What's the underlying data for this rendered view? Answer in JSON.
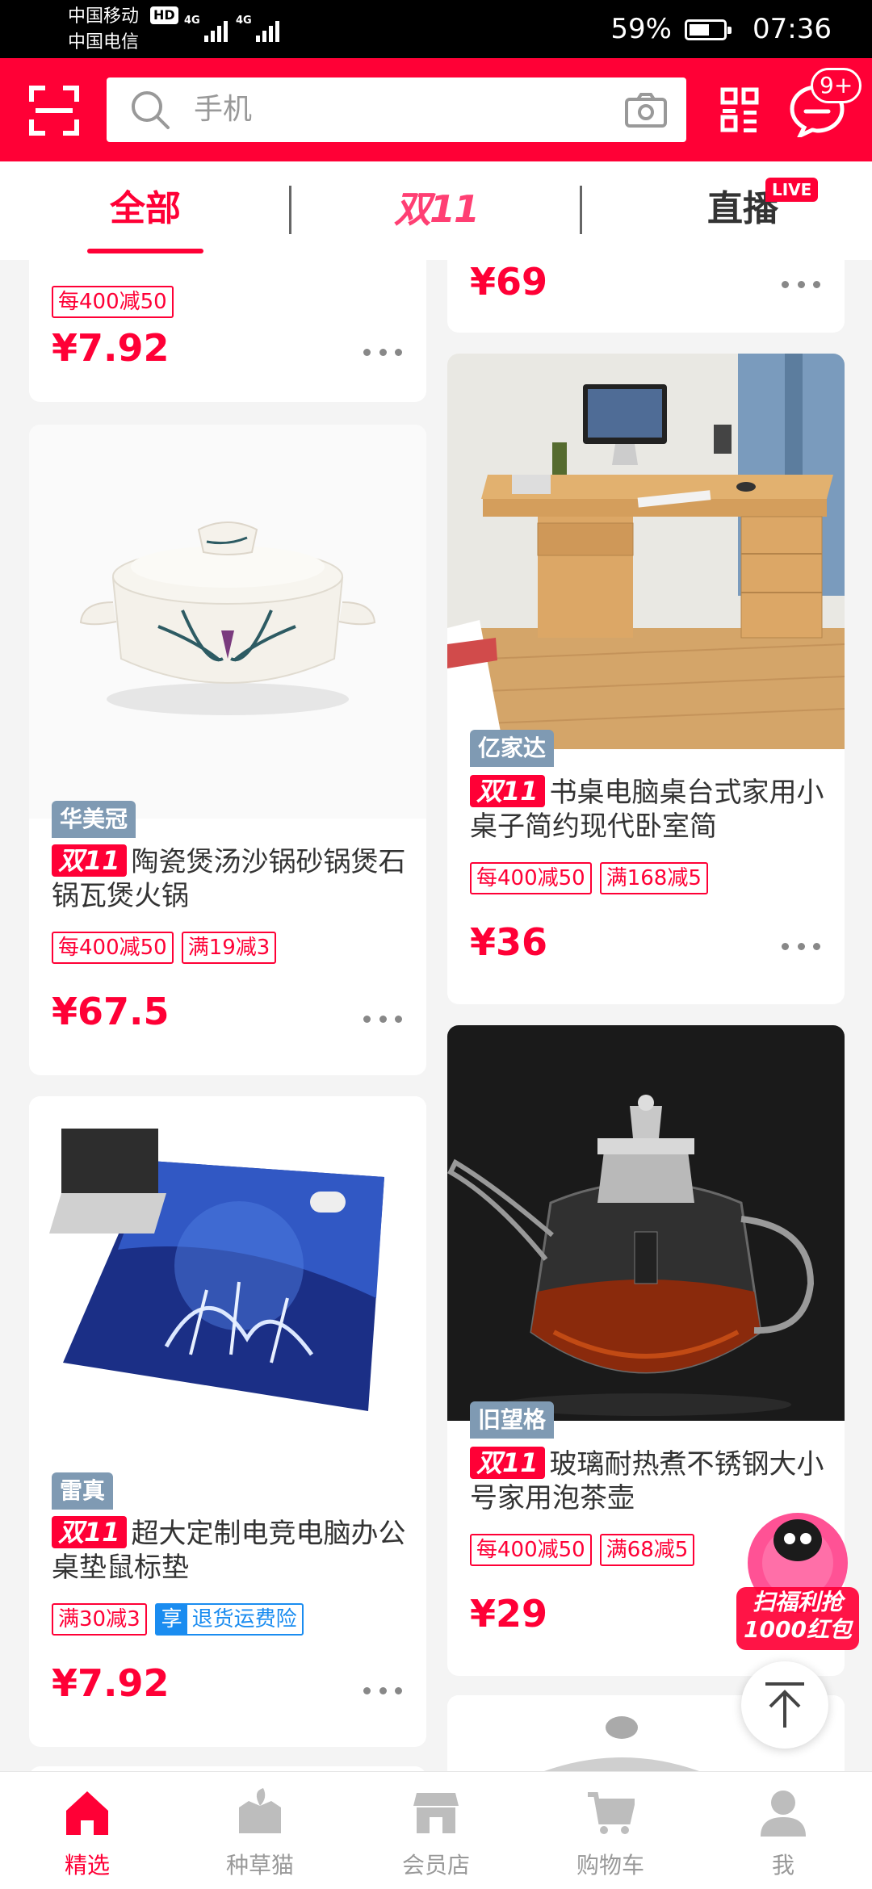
{
  "status_bar": {
    "carrier1": "中国移动",
    "hd": "HD",
    "carrier2": "中国电信",
    "net1": "4G",
    "net2": "4G",
    "battery_pct": "59%",
    "battery_level": 0.59,
    "time": "07:36"
  },
  "header": {
    "search_placeholder": "手机",
    "message_badge": "9+"
  },
  "tabs": {
    "all": "全部",
    "double11": "双11",
    "live": "直播",
    "live_badge": "LIVE"
  },
  "products": [
    {
      "promos": [
        "每400减50"
      ],
      "price": "¥7.92"
    },
    {
      "price": "¥69"
    },
    {
      "store": "华美冠",
      "tag": "双11",
      "title": "陶瓷煲汤沙锅砂锅煲石锅瓦煲火锅",
      "promos": [
        "每400减50",
        "满19减3"
      ],
      "price": "¥67.5"
    },
    {
      "store": "亿家达",
      "tag": "双11",
      "title": "书桌电脑桌台式家用小桌子简约现代卧室简",
      "promos": [
        "每400减50",
        "满168减5"
      ],
      "price": "¥36"
    },
    {
      "store": "雷真",
      "tag": "双11",
      "title": "超大定制电竞电脑办公桌垫鼠标垫",
      "promos": [
        "满30减3"
      ],
      "shipping_badge": "享",
      "shipping_text": "退货运费险",
      "price": "¥7.92"
    },
    {
      "store": "旧望格",
      "tag": "双11",
      "title": "玻璃耐热煮不锈钢大小号家用泡茶壶",
      "promos": [
        "每400减50",
        "满68减5"
      ],
      "price": "¥29"
    }
  ],
  "float_promo": {
    "line1": "扫福利抢",
    "line2": "1000红包"
  },
  "bottom_nav": [
    {
      "label": "精选",
      "icon": "home-icon",
      "active": true
    },
    {
      "label": "种草猫",
      "icon": "grass-cat-icon",
      "active": false
    },
    {
      "label": "会员店",
      "icon": "member-store-icon",
      "active": false
    },
    {
      "label": "购物车",
      "icon": "cart-icon",
      "active": false
    },
    {
      "label": "我",
      "icon": "profile-icon",
      "active": false
    }
  ],
  "colors": {
    "brand": "#ff0036",
    "store_tag": "#7f9ab3",
    "shipping": "#1a8cf0"
  }
}
